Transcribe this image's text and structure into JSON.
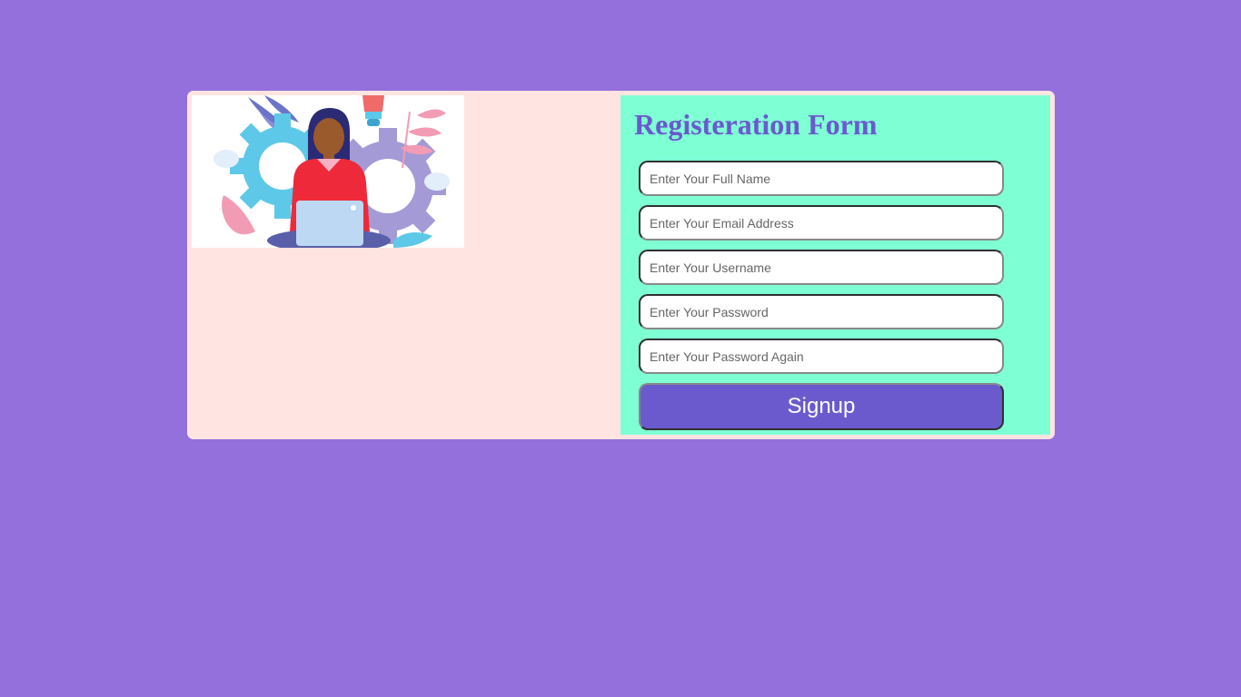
{
  "colors": {
    "page_background": "#9370DB",
    "card_background": "#FFE4E1",
    "form_background": "#7FFFD4",
    "accent": "#6A5ACD",
    "button_text": "#FFFFFF"
  },
  "illustration": {
    "icon": "woman-with-laptop-and-gears-illustration"
  },
  "form": {
    "title": "Registeration Form",
    "fields": [
      {
        "placeholder": "Enter Your Full Name",
        "value": ""
      },
      {
        "placeholder": "Enter Your Email Address",
        "value": ""
      },
      {
        "placeholder": "Enter Your Username",
        "value": ""
      },
      {
        "placeholder": "Enter Your Password",
        "value": ""
      },
      {
        "placeholder": "Enter Your Password Again",
        "value": ""
      }
    ],
    "submit_label": "Signup"
  }
}
